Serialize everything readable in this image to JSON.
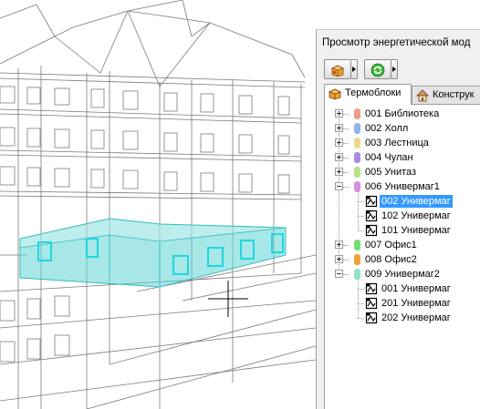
{
  "panel": {
    "title": "Просмотр энергетической мод"
  },
  "toolbar": {
    "buttons": [
      {
        "icon": "energy-model-icon"
      },
      {
        "icon": "refresh-icon"
      }
    ]
  },
  "tabs": [
    {
      "label": "Термоблоки",
      "icon": "thermal-blocks-icon",
      "active": true
    },
    {
      "label": "Конструк",
      "icon": "house-icon",
      "active": false
    }
  ],
  "tree": [
    {
      "label": "001 Библиотека",
      "color": "#ee9c86",
      "expanded": false,
      "children": []
    },
    {
      "label": "002 Холл",
      "color": "#8fb4e8",
      "expanded": false,
      "children": []
    },
    {
      "label": "003 Лестница",
      "color": "#ecd98c",
      "expanded": false,
      "children": []
    },
    {
      "label": "004 Чулан",
      "color": "#a98be0",
      "expanded": false,
      "children": []
    },
    {
      "label": "005 Унитаз",
      "color": "#b9e38a",
      "expanded": false,
      "children": []
    },
    {
      "label": "006 Универмаг1",
      "color": "#d690e0",
      "expanded": true,
      "children": [
        {
          "label": "002 Универмаг",
          "selected": true
        },
        {
          "label": "102 Универмаг",
          "selected": false
        },
        {
          "label": "101 Универмаг",
          "selected": false
        }
      ]
    },
    {
      "label": "007 Офис1",
      "color": "#75dc72",
      "expanded": false,
      "children": []
    },
    {
      "label": "008 Офис2",
      "color": "#f0a030",
      "expanded": false,
      "children": []
    },
    {
      "label": "009 Универмаг2",
      "color": "#8fe2c4",
      "expanded": true,
      "children": [
        {
          "label": "001 Универмаг",
          "selected": false
        },
        {
          "label": "201 Универмаг",
          "selected": false
        },
        {
          "label": "202 Универмаг",
          "selected": false
        }
      ]
    }
  ],
  "viewport": {
    "highlight_color": "#5fd4d4"
  }
}
